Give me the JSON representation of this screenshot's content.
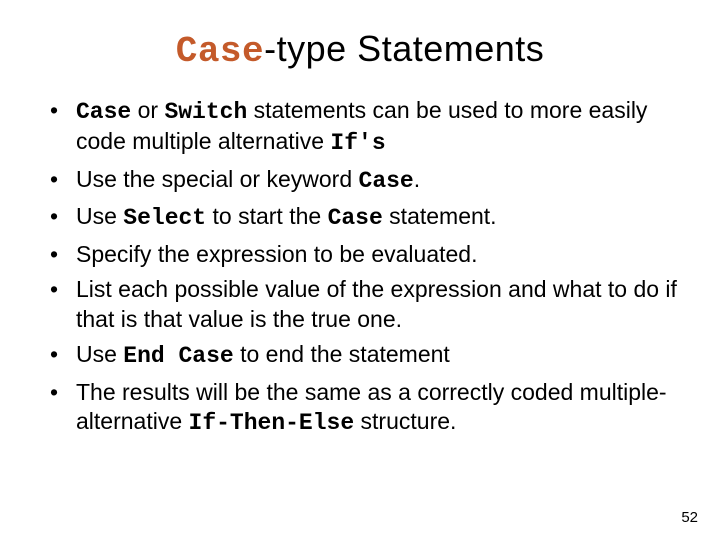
{
  "title": {
    "code": "Case",
    "rest": "-type Statements"
  },
  "bullets": [
    {
      "segments": [
        {
          "t": "Case",
          "mono": true
        },
        {
          "t": " or "
        },
        {
          "t": "Switch",
          "mono": true
        },
        {
          "t": " statements can be used to more easily code multiple alternative "
        },
        {
          "t": "If's",
          "mono": true
        }
      ]
    },
    {
      "segments": [
        {
          "t": "Use the special or keyword "
        },
        {
          "t": "Case",
          "mono": true
        },
        {
          "t": "."
        }
      ]
    },
    {
      "segments": [
        {
          "t": "Use "
        },
        {
          "t": "Select",
          "mono": true
        },
        {
          "t": " to start the "
        },
        {
          "t": "Case",
          "mono": true
        },
        {
          "t": " statement."
        }
      ]
    },
    {
      "segments": [
        {
          "t": "Specify the expression to be evaluated."
        }
      ]
    },
    {
      "segments": [
        {
          "t": "List each possible value of the expression and what to do if that is that value is the true one."
        }
      ]
    },
    {
      "segments": [
        {
          "t": "Use "
        },
        {
          "t": "End Case",
          "mono": true
        },
        {
          "t": " to end the statement"
        }
      ]
    },
    {
      "segments": [
        {
          "t": "The results will be the same as a correctly coded multiple-alternative "
        },
        {
          "t": "If-Then-Else",
          "mono": true
        },
        {
          "t": " structure."
        }
      ]
    }
  ],
  "page_number": "52"
}
